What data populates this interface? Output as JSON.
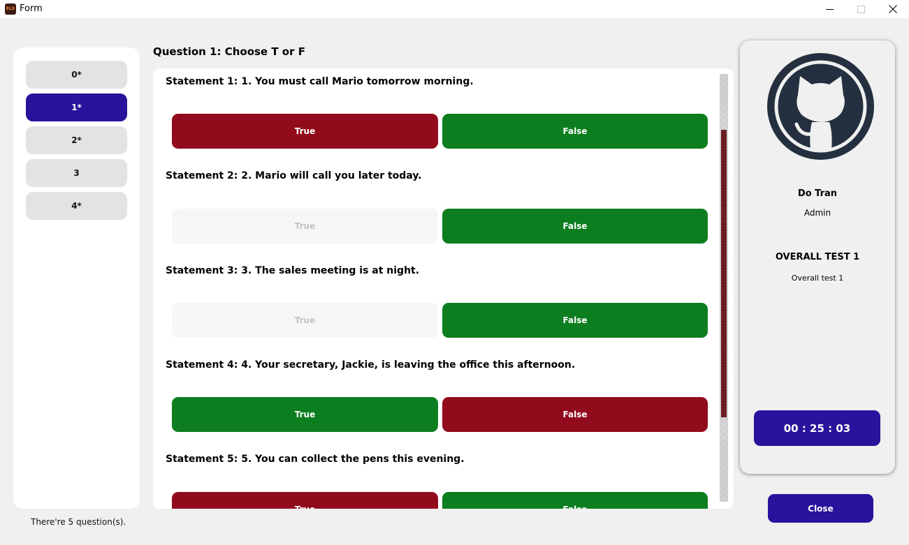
{
  "window": {
    "icon_text": "ELS",
    "title": "Form",
    "icons": {
      "minimize": "minimize-icon",
      "maximize": "maximize-icon",
      "close": "close-icon"
    }
  },
  "nav": {
    "items": [
      {
        "label": "0*",
        "active": false
      },
      {
        "label": "1*",
        "active": true
      },
      {
        "label": "2*",
        "active": false
      },
      {
        "label": "3",
        "active": false
      },
      {
        "label": "4*",
        "active": false
      }
    ],
    "footer": "There're 5 question(s)."
  },
  "question": {
    "title": "Question 1: Choose T or F",
    "true_label": "True",
    "false_label": "False",
    "statements": [
      {
        "text": "Statement 1: 1. You must call Mario tomorrow morning.",
        "true_state": "red",
        "false_state": "green"
      },
      {
        "text": "Statement 2: 2. Mario will call you later today.",
        "true_state": "muted",
        "false_state": "green"
      },
      {
        "text": "Statement 3: 3. The sales meeting is at night.",
        "true_state": "muted",
        "false_state": "green"
      },
      {
        "text": "Statement 4: 4. Your secretary, Jackie, is leaving the office this afternoon.",
        "true_state": "green",
        "false_state": "red"
      },
      {
        "text": "Statement 5: 5. You can collect the pens this evening.",
        "true_state": "red",
        "false_state": "green"
      }
    ]
  },
  "profile": {
    "avatar_icon": "github-octocat-icon",
    "name": "Do Tran",
    "role": "Admin",
    "test_title": "OVERALL TEST 1",
    "test_subtitle": "Overall test 1",
    "timer": "00 : 25 : 03"
  },
  "close_label": "Close",
  "colors": {
    "accent": "#2b129c",
    "selected_red": "#920b1c",
    "selected_green": "#0d7e1f",
    "scroll_thumb": "#6b1e22"
  }
}
